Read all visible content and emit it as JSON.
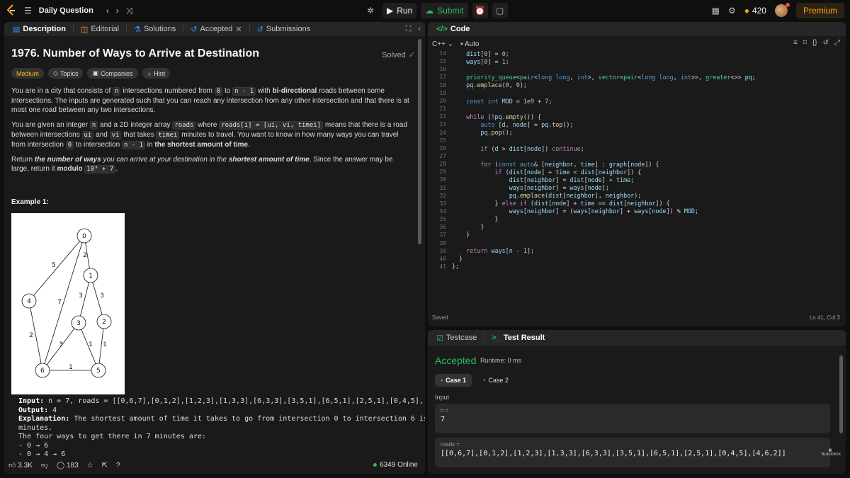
{
  "topbar": {
    "problem_list_label": "Daily Question",
    "run_label": "Run",
    "submit_label": "Submit",
    "streak_count": "420",
    "premium_label": "Premium"
  },
  "left_tabs": [
    {
      "label": "Description"
    },
    {
      "label": "Editorial"
    },
    {
      "label": "Solutions"
    },
    {
      "label": "Accepted"
    },
    {
      "label": "Submissions"
    }
  ],
  "problem": {
    "title": "1976. Number of Ways to Arrive at Destination",
    "status": "Solved",
    "difficulty": "Medium",
    "chips": [
      "Topics",
      "Companies",
      "Hint"
    ],
    "p1_a": "You are in a city that consists of ",
    "p1_n": "n",
    "p1_b": " intersections numbered from ",
    "p1_zero": "0",
    "p1_c": " to ",
    "p1_nm1": "n - 1",
    "p1_d": " with ",
    "p1_bold": "bi-directional",
    "p1_e": " roads between some intersections. The inputs are generated such that you can reach any intersection from any other intersection and that there is at most one road between any two intersections.",
    "p2_a": "You are given an integer ",
    "p2_n": "n",
    "p2_b": " and a 2D integer array ",
    "p2_roads": "roads",
    "p2_c": " where ",
    "p2_roadsi": "roads[i] = [ui, vi, timei]",
    "p2_d": " means that there is a road between intersections ",
    "p2_ui": "ui",
    "p2_e": " and ",
    "p2_vi": "vi",
    "p2_f": " that takes ",
    "p2_timei": "timei",
    "p2_g": " minutes to travel. You want to know in how many ways you can travel from intersection ",
    "p2_zero": "0",
    "p2_h": " to intersection ",
    "p2_nm1": "n - 1",
    "p2_i": " in ",
    "p2_bold": "the shortest amount of time",
    "p2_j": ".",
    "p3_a": "Return ",
    "p3_bold1": "the number of ways",
    "p3_b": " you can arrive at your destination in the ",
    "p3_bold2": "shortest amount of time",
    "p3_c": ". Since the answer may be large, return it ",
    "p3_bold3": "modulo",
    "p3_mod": "10⁹ + 7",
    "p3_d": ".",
    "example_title": "Example 1:",
    "ex_input_label": "Input:",
    "ex_input": " n = 7, roads = [[0,6,7],[0,1,2],[1,2,3],[1,3,3],[6,3,3],[3,5,1],[6,5,1],[2,5,1],[0,4,5],[4,6,2]]",
    "ex_output_label": "Output:",
    "ex_output": " 4",
    "ex_expl_label": "Explanation:",
    "ex_expl": " The shortest amount of time it takes to go from intersection 0 to intersection 6 is 7",
    "ex_expl2": "minutes.",
    "ex_ways": "The four ways to get there in 7 minutes are:",
    "ex_way1": "- 0 → 6",
    "ex_way2": "- 0 → 4 → 6"
  },
  "graph": {
    "nodes": [
      "0",
      "1",
      "2",
      "3",
      "4",
      "5",
      "6"
    ],
    "weights": [
      "5",
      "2",
      "7",
      "3",
      "3",
      "2",
      "3",
      "1",
      "1",
      "1"
    ]
  },
  "footer": {
    "likes": "3.3K",
    "comments": "183",
    "online": "6349 Online"
  },
  "code_panel": {
    "title": "Code",
    "language": "C++",
    "mode": "Auto",
    "saved": "Saved",
    "cursor": "Ln 41, Col 3",
    "line_numbers": [
      "14",
      "15",
      "16",
      "17",
      "18",
      "19",
      "20",
      "21",
      "22",
      "23",
      "24",
      "25",
      "26",
      "27",
      "28",
      "29",
      "30",
      "31",
      "32",
      "33",
      "34",
      "35",
      "36",
      "37",
      "38",
      "39",
      "40",
      "41"
    ]
  },
  "result_panel": {
    "tab_testcase": "Testcase",
    "tab_result": "Test Result",
    "status": "Accepted",
    "runtime": "Runtime: 0 ms",
    "case1": "Case 1",
    "case2": "Case 2",
    "input_label": "Input",
    "n_label": "n =",
    "n_value": "7",
    "roads_label": "roads =",
    "roads_value": "[[0,6,7],[0,1,2],[1,2,3],[1,3,3],[6,3,3],[3,5,1],[6,5,1],[2,5,1],[0,4,5],[4,6,2]]"
  }
}
